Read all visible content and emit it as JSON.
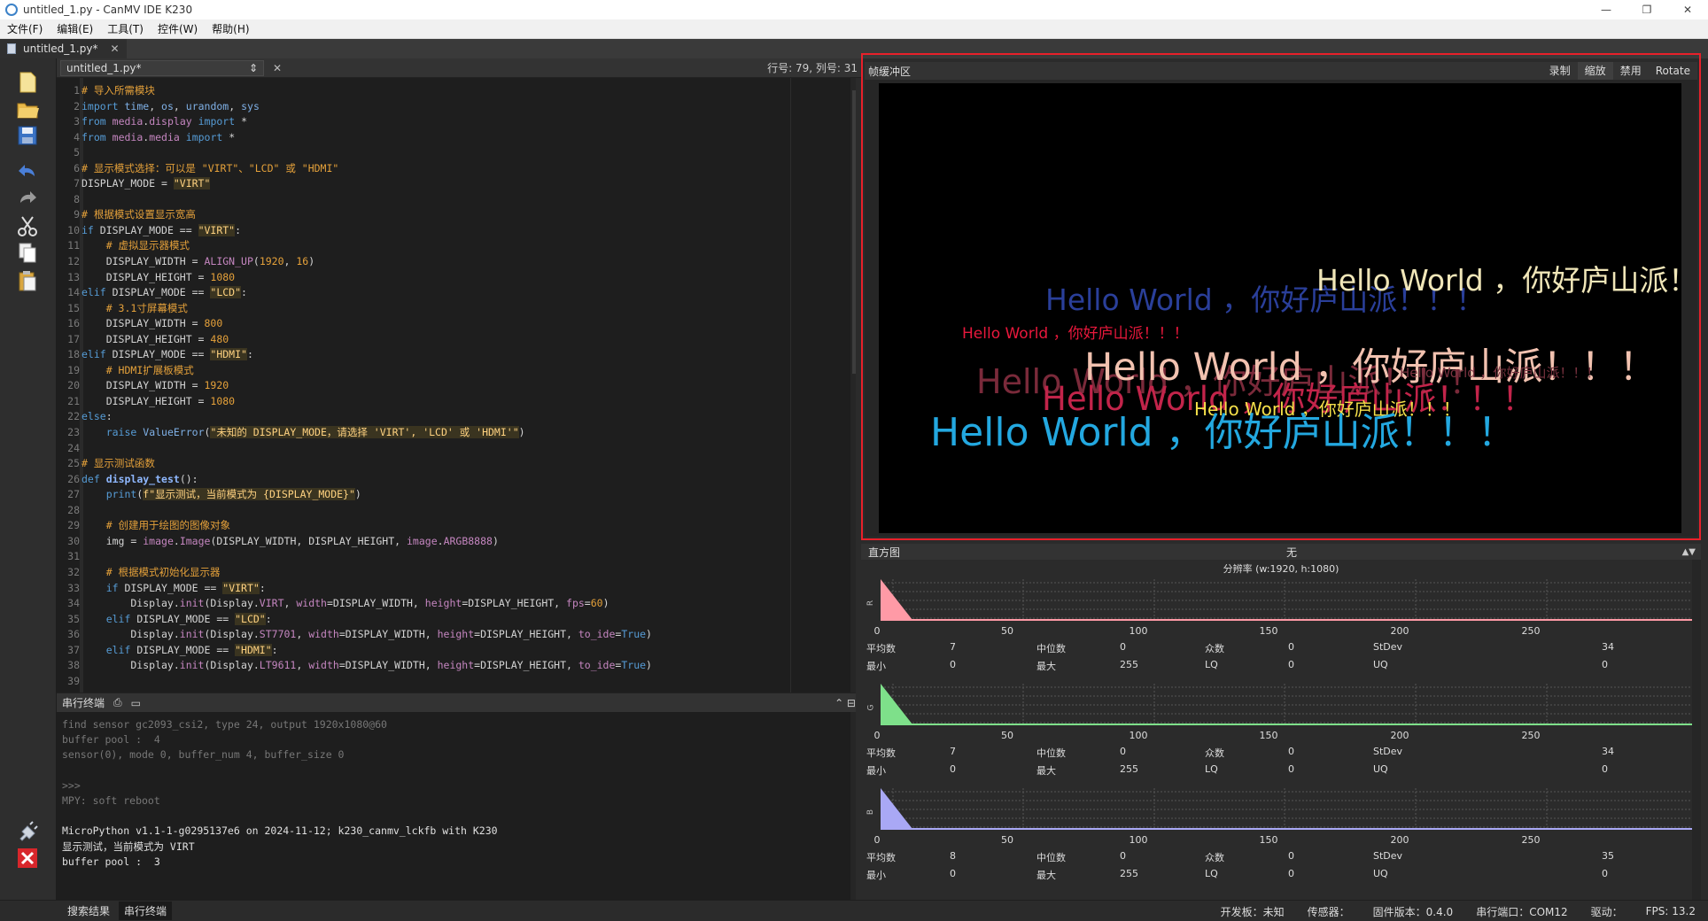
{
  "window": {
    "title": "untitled_1.py - CanMV IDE K230",
    "controls": [
      "—",
      "❐",
      "✕"
    ]
  },
  "menu": [
    "文件(F)",
    "编辑(E)",
    "工具(T)",
    "控件(W)",
    "帮助(H)"
  ],
  "doc_tab": {
    "label": "untitled_1.py*",
    "close": "✕"
  },
  "editor": {
    "file_combo": "untitled_1.py*",
    "combo_arrow": "⇕",
    "close": "✕",
    "cursor_position": "行号: 79, 列号: 31",
    "line_numbers": [
      "1",
      "2",
      "3",
      "4",
      "5",
      "6",
      "7",
      "8",
      "9",
      "10",
      "11",
      "12",
      "13",
      "14",
      "15",
      "16",
      "17",
      "18",
      "19",
      "20",
      "21",
      "22",
      "23",
      "24",
      "25",
      "26",
      "27",
      "28",
      "29",
      "30",
      "31",
      "32",
      "33",
      "34",
      "35",
      "36",
      "37",
      "38",
      "39"
    ],
    "code": [
      "# 导入所需模块",
      "import time, os, urandom, sys",
      "from media.display import *",
      "from media.media import *",
      "",
      "# 显示模式选择：可以是 \"VIRT\"、\"LCD\" 或 \"HDMI\"",
      "DISPLAY_MODE = \"VIRT\"",
      "",
      "# 根据模式设置显示宽高",
      "if DISPLAY_MODE == \"VIRT\":",
      "    # 虚拟显示器模式",
      "    DISPLAY_WIDTH = ALIGN_UP(1920, 16)",
      "    DISPLAY_HEIGHT = 1080",
      "elif DISPLAY_MODE == \"LCD\":",
      "    # 3.1寸屏幕模式",
      "    DISPLAY_WIDTH = 800",
      "    DISPLAY_HEIGHT = 480",
      "elif DISPLAY_MODE == \"HDMI\":",
      "    # HDMI扩展板模式",
      "    DISPLAY_WIDTH = 1920",
      "    DISPLAY_HEIGHT = 1080",
      "else:",
      "    raise ValueError(\"未知的 DISPLAY_MODE，请选择 'VIRT', 'LCD' 或 'HDMI'\")",
      "",
      "# 显示测试函数",
      "def display_test():",
      "    print(f\"显示测试，当前模式为 {DISPLAY_MODE}\")",
      "",
      "    # 创建用于绘图的图像对象",
      "    img = image.Image(DISPLAY_WIDTH, DISPLAY_HEIGHT, image.ARGB8888)",
      "",
      "    # 根据模式初始化显示器",
      "    if DISPLAY_MODE == \"VIRT\":",
      "        Display.init(Display.VIRT, width=DISPLAY_WIDTH, height=DISPLAY_HEIGHT, fps=60)",
      "    elif DISPLAY_MODE == \"LCD\":",
      "        Display.init(Display.ST7701, width=DISPLAY_WIDTH, height=DISPLAY_HEIGHT, to_ide=True)",
      "    elif DISPLAY_MODE == \"HDMI\":",
      "        Display.init(Display.LT9611, width=DISPLAY_WIDTH, height=DISPLAY_HEIGHT, to_ide=True)",
      ""
    ]
  },
  "terminal": {
    "title": "串行终端",
    "lines": [
      "find sensor gc2093_csi2, type 24, output 1920x1080@60",
      "buffer pool :  4",
      "sensor(0), mode 0, buffer_num 4, buffer_size 0",
      "",
      ">>>",
      "MPY: soft reboot",
      "",
      "MicroPython v1.1-1-g0295137e6 on 2024-11-12; k230_canmv_lckfb with K230",
      "显示测试，当前模式为 VIRT",
      "buffer pool :  3"
    ],
    "bright_from": 7
  },
  "frame_buffer": {
    "title": "帧缓冲区",
    "actions": [
      "录制",
      "缩放",
      "禁用",
      "Rotate"
    ],
    "texts": [
      {
        "text": "Hello World  ，你好庐山派！！！",
        "color": "#f0e6b8"
      },
      {
        "text": "Hello World  ，你好庐山派！！！",
        "color": "#2a3f9a"
      },
      {
        "text": "Hello World  ，你好庐山派！！！",
        "color": "#e8183c"
      },
      {
        "text": "Hello World  ，你好庐山派！！！",
        "color": "#f2c2b0"
      },
      {
        "text": "Hello World  ，你好庐山派！！！",
        "color": "#7a2a3a"
      },
      {
        "text": "Hello World  ，你好庐山派！！！",
        "color": "#c2244a"
      },
      {
        "text": "Hello World  ，你好庐山派！！！",
        "color": "#f5e04a"
      },
      {
        "text": "Hello World  ，你好庐山派！！！",
        "color": "#23a8e0"
      },
      {
        "text": "Hello World  ，你好庐山派！！！",
        "color": "#7a3340"
      }
    ]
  },
  "histogram": {
    "title": "直方图",
    "colorspace": "无",
    "resolution": "分辨率 (w:1920, h:1080)",
    "axis_ticks": [
      "0",
      "50",
      "100",
      "150",
      "200",
      "250"
    ],
    "stat_labels": {
      "mean": "平均数",
      "median": "中位数",
      "mode": "众数",
      "stdev": "StDev",
      "min": "最小",
      "max": "最大",
      "lq": "LQ",
      "uq": "UQ"
    },
    "channels": [
      {
        "name": "R",
        "color": "#ff9aa6",
        "mean": "7",
        "median": "0",
        "mode": "0",
        "stdev": "34",
        "min": "0",
        "max": "255",
        "lq": "0",
        "uq": "0"
      },
      {
        "name": "G",
        "color": "#7ee08a",
        "mean": "7",
        "median": "0",
        "mode": "0",
        "stdev": "34",
        "min": "0",
        "max": "255",
        "lq": "0",
        "uq": "0"
      },
      {
        "name": "B",
        "color": "#a9a8f5",
        "mean": "8",
        "median": "0",
        "mode": "0",
        "stdev": "35",
        "min": "0",
        "max": "255",
        "lq": "0",
        "uq": "0"
      }
    ]
  },
  "bottom_tabs": [
    "搜索结果",
    "串行终端"
  ],
  "status": {
    "board": "开发板：未知",
    "sensor": "传感器：",
    "firmware": "固件版本：0.4.0",
    "port": "串行端口：COM12",
    "driver": "驱动：",
    "fps": "FPS:  13.2"
  }
}
